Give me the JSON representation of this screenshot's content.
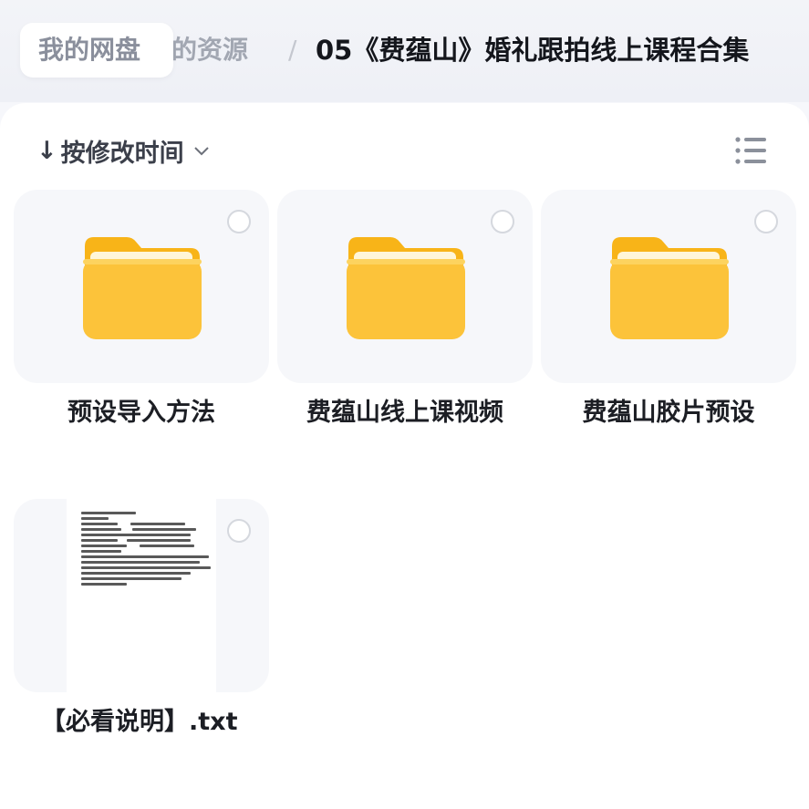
{
  "breadcrumb": {
    "root": "我的网盘",
    "middle": "我的资源",
    "separator": "/",
    "current": "05《费蕴山》婚礼跟拍线上课程合集"
  },
  "toolbar": {
    "sort_label": "按修改时间",
    "sort_arrow": "↓",
    "sort_chevron_icon": "chevron-down-icon",
    "view_toggle_icon": "list-view-icon"
  },
  "files": [
    {
      "name": "预设导入方法",
      "type": "folder",
      "icon": "folder-icon"
    },
    {
      "name": "费蕴山线上课视频",
      "type": "folder",
      "icon": "folder-icon"
    },
    {
      "name": "费蕴山胶片预设",
      "type": "folder",
      "icon": "folder-icon"
    },
    {
      "name": "【必看说明】.txt",
      "type": "text",
      "icon": "txt-preview-icon"
    }
  ],
  "colors": {
    "folder_front": "#fcc33a",
    "folder_back": "#f8b418",
    "text_primary": "#1c1e24",
    "card_bg": "#f6f7fa"
  }
}
